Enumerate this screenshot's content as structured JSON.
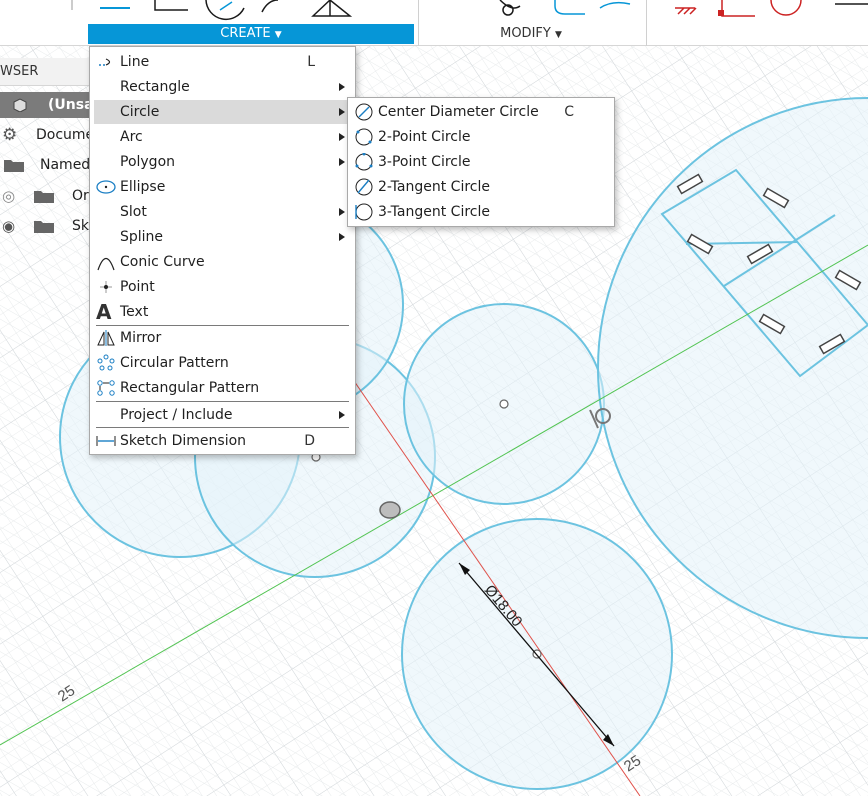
{
  "toolbar": {
    "create_label": "CREATE",
    "modify_label": "MODIFY"
  },
  "browser": {
    "header": "WSER",
    "rows": [
      {
        "label": "(Unsa",
        "icon": "component-icon"
      },
      {
        "label": "Docume",
        "icon": "gear-icon"
      },
      {
        "label": "Named",
        "icon": "folder-icon"
      },
      {
        "label": "Or",
        "icon": "folder-icon"
      },
      {
        "label": "Sk",
        "icon": "folder-icon"
      }
    ]
  },
  "create_menu": {
    "items": [
      {
        "label": "Line",
        "key": "L",
        "icon": "line-icon"
      },
      {
        "label": "Rectangle",
        "submenu": true,
        "icon": "rectangle-icon"
      },
      {
        "label": "Circle",
        "submenu": true,
        "icon": "circle-icon",
        "highlighted": true
      },
      {
        "label": "Arc",
        "submenu": true,
        "icon": "arc-icon"
      },
      {
        "label": "Polygon",
        "submenu": true,
        "icon": "polygon-icon"
      },
      {
        "label": "Ellipse",
        "icon": "ellipse-icon"
      },
      {
        "label": "Slot",
        "submenu": true,
        "icon": "slot-icon"
      },
      {
        "label": "Spline",
        "submenu": true,
        "icon": "spline-icon"
      },
      {
        "label": "Conic Curve",
        "icon": "conic-curve-icon"
      },
      {
        "label": "Point",
        "icon": "point-icon"
      },
      {
        "label": "Text",
        "icon": "text-icon"
      },
      {
        "label": "Mirror",
        "icon": "mirror-icon"
      },
      {
        "label": "Circular Pattern",
        "icon": "circular-pattern-icon"
      },
      {
        "label": "Rectangular Pattern",
        "icon": "rectangular-pattern-icon"
      },
      {
        "label": "Project / Include",
        "submenu": true,
        "icon": "project-icon"
      },
      {
        "label": "Sketch Dimension",
        "key": "D",
        "icon": "sketch-dimension-icon"
      }
    ]
  },
  "circle_submenu": {
    "items": [
      {
        "label": "Center Diameter Circle",
        "key": "C",
        "icon": "center-diameter-circle-icon"
      },
      {
        "label": "2-Point Circle",
        "icon": "two-point-circle-icon"
      },
      {
        "label": "3-Point Circle",
        "icon": "three-point-circle-icon"
      },
      {
        "label": "2-Tangent Circle",
        "icon": "two-tangent-circle-icon"
      },
      {
        "label": "3-Tangent Circle",
        "icon": "three-tangent-circle-icon"
      }
    ]
  },
  "canvas": {
    "dimension_label": "Ø18.00",
    "axis_label_left": "25",
    "axis_label_bottom": "25",
    "colors": {
      "circle_stroke": "#6cc3e0",
      "circle_fill": "#e4f2f9",
      "x_axis": "#e0524b",
      "y_axis": "#52c452",
      "grid": "#d9dde0",
      "accent": "#0696d7"
    }
  }
}
